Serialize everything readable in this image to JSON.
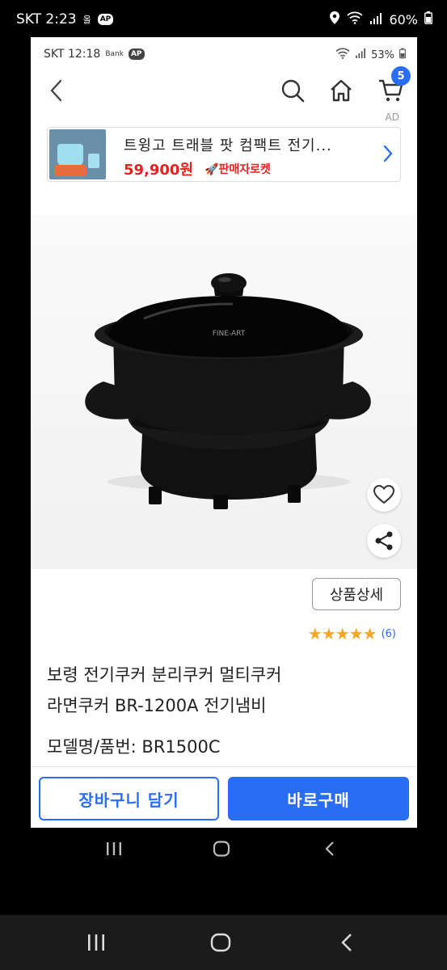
{
  "outer_status": {
    "carrier_time": "SKT 2:23",
    "indicator": "올",
    "badge": "AP",
    "battery": "60%"
  },
  "inner_status": {
    "carrier_time": "SKT 12:18",
    "bank_label": "Bank",
    "badge": "AP",
    "battery": "53%"
  },
  "header": {
    "cart_count": "5"
  },
  "ad": {
    "label": "AD",
    "title": "트윙고 트래블 팟 컴팩트 전기...",
    "price": "59,900원",
    "rocket_label": "판매자로켓"
  },
  "product": {
    "detail_button": "상품상세",
    "stars": "★★★★★",
    "review_count": "(6)",
    "title_line1": "보령 전기쿠커 분리쿠커 멀티쿠커",
    "title_line2": "라면쿠커 BR-1200A 전기냄비",
    "model": "모델명/품번: BR1500C",
    "image_brand": "FINE-ART"
  },
  "actions": {
    "add_to_cart": "장바구니 담기",
    "buy_now": "바로구매"
  },
  "colors": {
    "accent": "#2a6df5",
    "price": "#e8201e",
    "star": "#f5a623"
  }
}
